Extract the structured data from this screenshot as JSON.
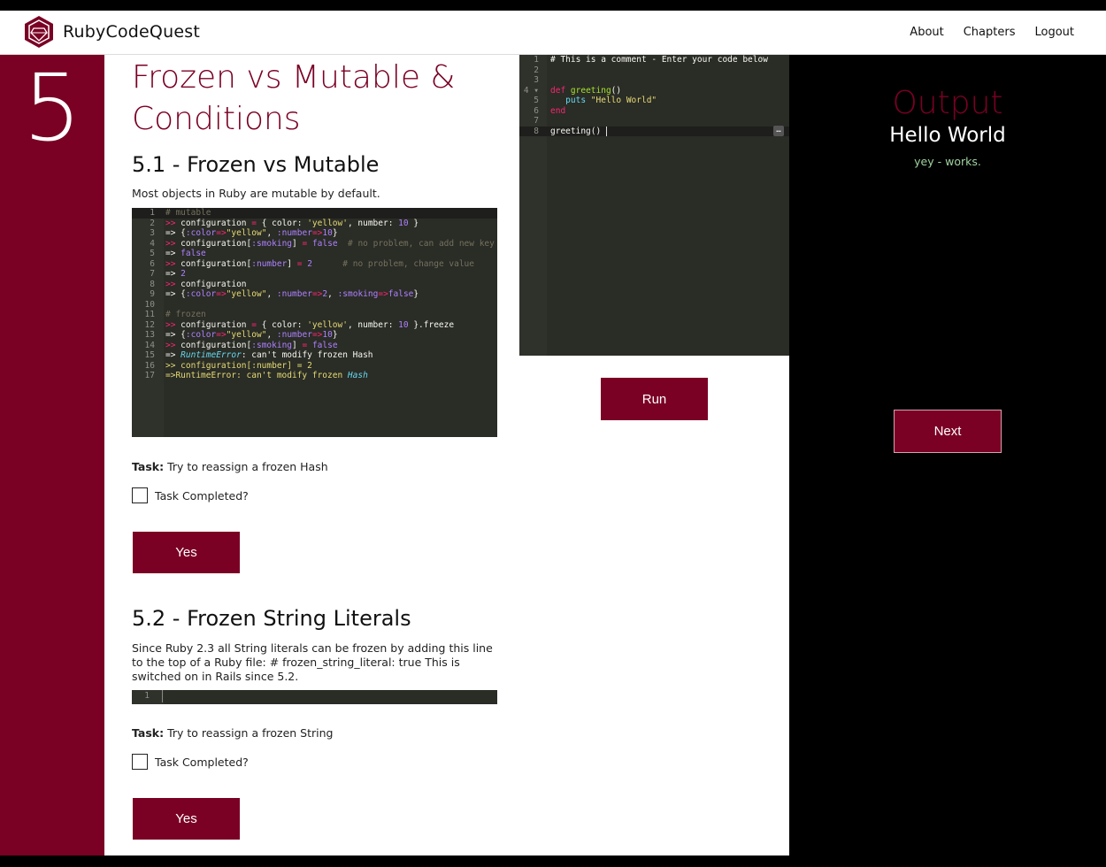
{
  "header": {
    "brand": "RubyCodeQuest",
    "nav": [
      "About",
      "Chapters",
      "Logout"
    ]
  },
  "chapter": {
    "number": "5",
    "title": "Frozen vs Mutable & Conditions"
  },
  "section1": {
    "title": "5.1 - Frozen vs Mutable",
    "description": "Most objects in Ruby are mutable by default.",
    "task_label": "Task:",
    "task_text": " Try to reassign a frozen Hash",
    "checkbox_label": "Task Completed?",
    "button_label": "Yes"
  },
  "section2": {
    "title": "5.2 - Frozen String Literals",
    "description": "Since Ruby 2.3 all String literals can be frozen by adding this line to the top of a Ruby file: # frozen_string_literal: true This is switched on in Rails since 5.2.",
    "task_label": "Task:",
    "task_text": " Try to reassign a frozen String",
    "checkbox_label": "Task Completed?",
    "button_label": "Yes"
  },
  "editor": {
    "lines": [
      "# This is a comment - Enter your code below",
      "",
      "",
      "def greeting()",
      "   puts \"Hello World\"",
      "end",
      "",
      "greeting()"
    ],
    "run_label": "Run"
  },
  "output": {
    "title": "Output",
    "text": "Hello World",
    "message": "yey - works.",
    "next_label": "Next"
  },
  "colors": {
    "accent": "#7a0024",
    "editor_bg": "#2a2c26",
    "output_bg": "#000000"
  }
}
